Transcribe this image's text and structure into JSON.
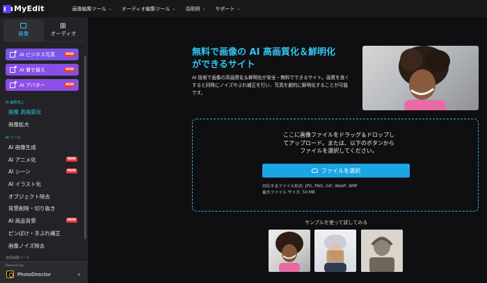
{
  "app": {
    "name": "MyEdit"
  },
  "topnav": [
    {
      "label": "画像編集ツール"
    },
    {
      "label": "オーディオ編集ツール"
    },
    {
      "label": "活用例"
    },
    {
      "label": "サポート"
    }
  ],
  "sidebar": {
    "tabs": [
      {
        "label": "画像",
        "icon": "image-icon",
        "active": true
      },
      {
        "label": "オーディオ",
        "icon": "audio-wave-icon",
        "active": false
      }
    ],
    "ai_buttons": [
      {
        "label": "AI ビジネス写真",
        "badge": "NEW",
        "color": "#7b55e6"
      },
      {
        "label": "AI 着せ替え",
        "badge": "NEW",
        "color": "#8650e8"
      },
      {
        "label": "AI アバター",
        "badge": "NEW",
        "color": "#8b4fe6"
      }
    ],
    "section_quality": "AI 画質向上",
    "quality_items": [
      {
        "label": "画像 高画質化",
        "active": true
      },
      {
        "label": "画像拡大",
        "active": false
      }
    ],
    "section_tools": "AI ツール",
    "tool_items": [
      {
        "label": "AI 画像生成",
        "badge": ""
      },
      {
        "label": "AI アニメ化",
        "badge": "NEW"
      },
      {
        "label": "AI シーン",
        "badge": "NEW"
      },
      {
        "label": "AI イラスト化",
        "badge": ""
      },
      {
        "label": "オブジェクト除去",
        "badge": ""
      },
      {
        "label": "背景削除・切り抜き",
        "badge": ""
      },
      {
        "label": "AI 商品背景",
        "badge": "NEW"
      },
      {
        "label": "ピンぼけ・手ぶれ補正",
        "badge": ""
      },
      {
        "label": "画像ノイズ除去",
        "badge": ""
      }
    ],
    "section_edit": "画像編集ツール",
    "powered_by": "Powered by",
    "powered_app": "PhotoDirector"
  },
  "hero": {
    "title_line1": "無料で画像の AI 高画質化＆鮮明化",
    "title_line2": "ができるサイト",
    "description": "AI 技術で画像の高画質化＆鮮明化が安全・無料でできるサイト。画質を良くすると同時にノイズやぶれ補正を行い、写真を劇的に鮮明化することが可能です。"
  },
  "upload": {
    "text_line1": "ここに画像ファイルをドラッグ＆ドロップし",
    "text_line2": "てアップロード。または、以下のボタンから",
    "text_line3": "ファイルを選択してください。",
    "button_label": "ファイルを選択",
    "formats": "対応するファイル形式: JPG, PNG, GIF, WebP, BMP",
    "max_size": "最大ファイル サイズ: 50 MB"
  },
  "samples": {
    "label": "サンプルを使って試してみる"
  },
  "colors": {
    "accent": "#34c5f2",
    "button": "#1ba5e3",
    "badge": "#ef3b3b"
  }
}
